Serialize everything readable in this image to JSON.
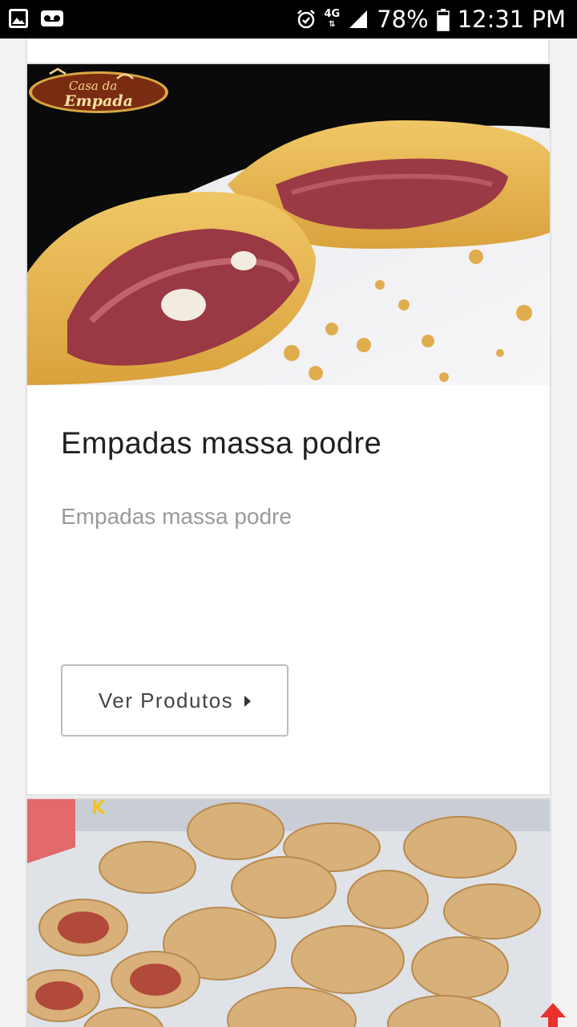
{
  "status_bar": {
    "icons_left": [
      "image-icon",
      "voicemail-icon"
    ],
    "alarm_icon": "alarm-icon",
    "network": "4G",
    "signal_icon": "signal-icon",
    "battery_percent": "78%",
    "battery_level": 0.78,
    "time": "12:31 PM"
  },
  "card": {
    "logo": {
      "line1": "Casa da",
      "line2": "Empada"
    },
    "title": "Empadas massa podre",
    "description": "Empadas massa podre",
    "button_label": "Ver Produtos",
    "button_icon": "caret-right-icon"
  },
  "scroll_top_icon": "arrow-up-icon",
  "colors": {
    "accent_red": "#e8322a",
    "logo_brown": "#7a2c12",
    "logo_gold": "#d8a640"
  }
}
